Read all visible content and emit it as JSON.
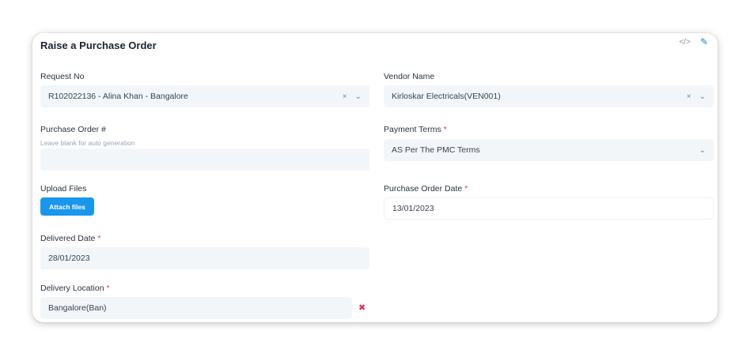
{
  "form": {
    "title": "Raise a Purchase Order",
    "header_icons": [
      "code-icon",
      "pencil-icon"
    ],
    "request_no": {
      "label": "Request No",
      "value": "R102022136 - Alina Khan - Bangalore"
    },
    "vendor_name": {
      "label": "Vendor Name",
      "value": "Kirloskar Electricals(VEN001)"
    },
    "purchase_order_no": {
      "label": "Purchase Order #",
      "hint": "Leave blank for auto generation",
      "value": ""
    },
    "payment_terms": {
      "label": "Payment Terms",
      "required": "*",
      "value": "AS Per The PMC Terms"
    },
    "upload_files": {
      "label": "Upload Files",
      "button": "Attach files"
    },
    "purchase_order_date": {
      "label": "Purchase Order Date",
      "required": "*",
      "value": "13/01/2023"
    },
    "delivered_date": {
      "label": "Delivered Date",
      "required": "*",
      "value": "28/01/2023"
    },
    "delivery_location": {
      "label": "Delivery Location",
      "required": "*",
      "value": "Bangalore(Ban)"
    }
  },
  "glyphs": {
    "clear": "×",
    "chevron": "⌄",
    "remove": "✖",
    "code": "</>",
    "pencil": "✎"
  },
  "colors": {
    "accent": "#1a96ec",
    "required": "#e03455",
    "field_bg": "#f3f6f9"
  }
}
